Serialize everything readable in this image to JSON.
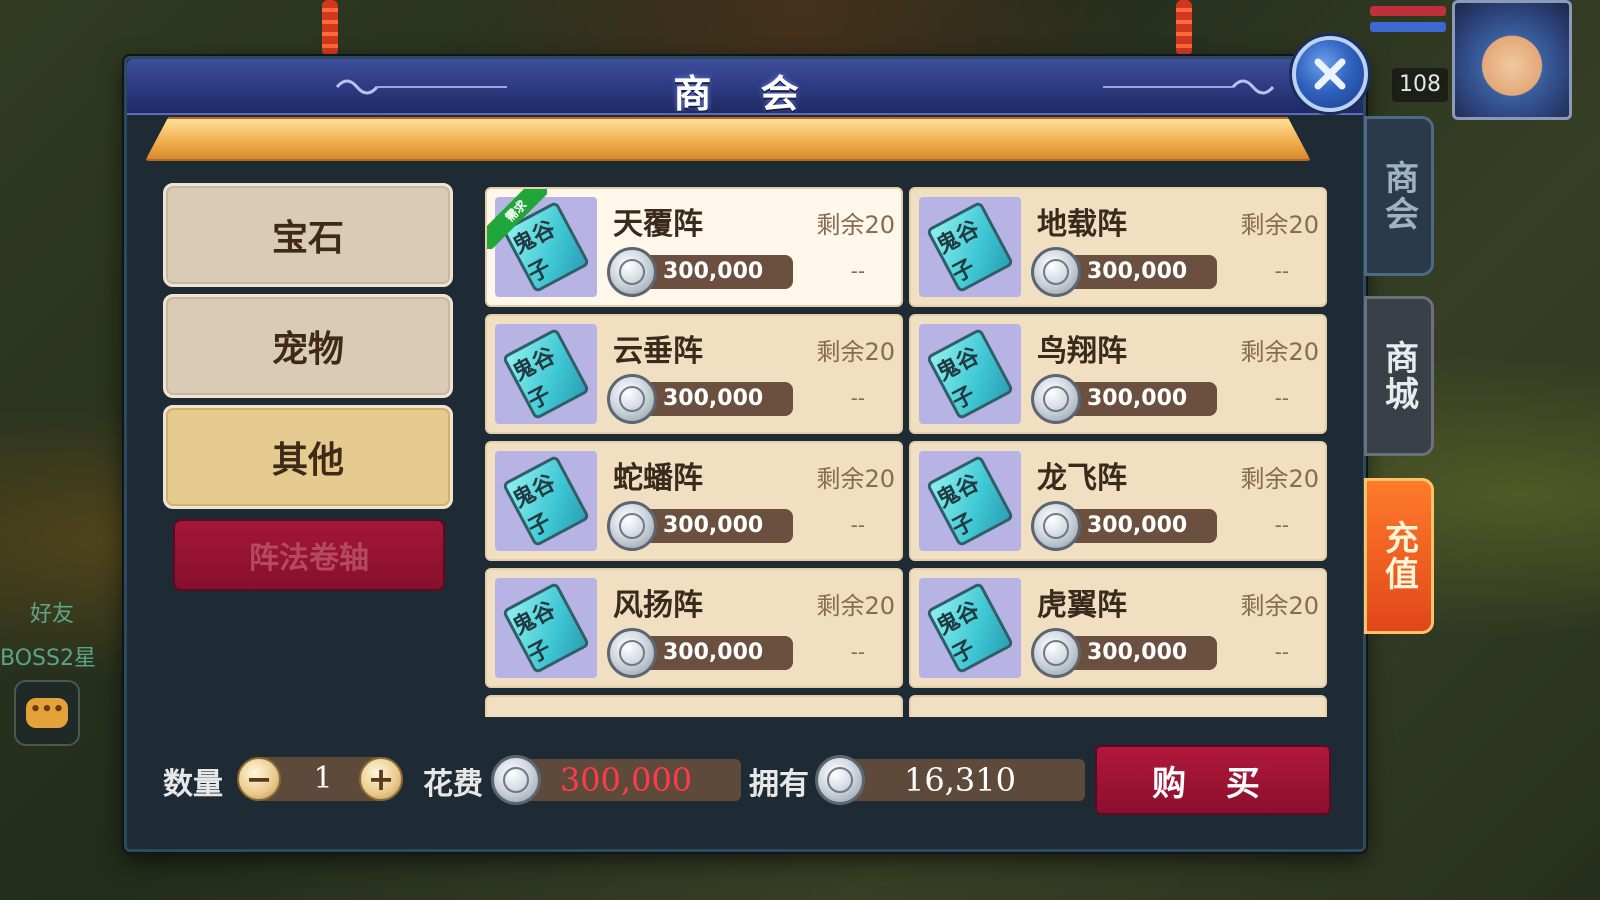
{
  "dialog": {
    "title": "商 会"
  },
  "categories": [
    {
      "label": "宝石",
      "active": false
    },
    {
      "label": "宠物",
      "active": false
    },
    {
      "label": "其他",
      "active": true
    }
  ],
  "subcategory_button": "阵法卷轴",
  "items": [
    {
      "name": "天覆阵",
      "remaining": "剩余20",
      "price": "300,000",
      "dash": "--",
      "tag": "需求",
      "selected": true
    },
    {
      "name": "地载阵",
      "remaining": "剩余20",
      "price": "300,000",
      "dash": "--"
    },
    {
      "name": "云垂阵",
      "remaining": "剩余20",
      "price": "300,000",
      "dash": "--"
    },
    {
      "name": "鸟翔阵",
      "remaining": "剩余20",
      "price": "300,000",
      "dash": "--"
    },
    {
      "name": "蛇蟠阵",
      "remaining": "剩余20",
      "price": "300,000",
      "dash": "--"
    },
    {
      "name": "龙飞阵",
      "remaining": "剩余20",
      "price": "300,000",
      "dash": "--"
    },
    {
      "name": "风扬阵",
      "remaining": "剩余20",
      "price": "300,000",
      "dash": "--"
    },
    {
      "name": "虎翼阵",
      "remaining": "剩余20",
      "price": "300,000",
      "dash": "--"
    }
  ],
  "item_icon_glyph": "鬼谷子",
  "bottom": {
    "quantity_label": "数量",
    "quantity_value": "1",
    "minus": "−",
    "plus": "+",
    "cost_label": "花费",
    "cost_value": "300,000",
    "owned_label": "拥有",
    "owned_value": "16,310",
    "buy_label": "购 买"
  },
  "side_tabs": [
    {
      "label": "商会"
    },
    {
      "label": "商城"
    },
    {
      "label": "充值"
    }
  ],
  "hud": {
    "level": "108"
  },
  "world_text": {
    "friend": "好友",
    "boss": "BOSS2星",
    "chat": "•••"
  },
  "colors": {
    "cost_red": "#ff3a4a",
    "title_blue": "#2d3b82",
    "buy_red": "#a3163a",
    "card_bg": "#f1dfc2"
  },
  "icons": {
    "close": "close-icon",
    "coin": "silver-coin-icon",
    "book": "scroll-book-icon"
  }
}
